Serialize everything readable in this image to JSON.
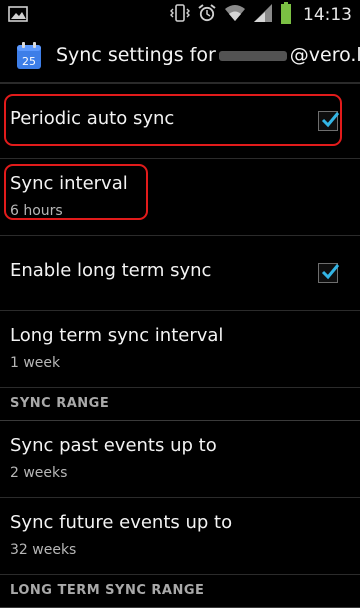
{
  "status_bar": {
    "time": "14:13",
    "icons": [
      "image-icon",
      "vibrate-icon",
      "alarm-icon",
      "wifi-icon",
      "signal-icon",
      "battery-icon"
    ]
  },
  "action_bar": {
    "title_prefix": "Sync settings for",
    "title_suffix": "@vero.lt",
    "icon": "calendar-icon",
    "icon_number": "25"
  },
  "settings": {
    "periodic_auto_sync": {
      "title": "Periodic auto sync",
      "checked": true
    },
    "sync_interval": {
      "title": "Sync interval",
      "summary": "6 hours"
    },
    "enable_long_term_sync": {
      "title": "Enable long term sync",
      "checked": true
    },
    "long_term_sync_interval": {
      "title": "Long term sync interval",
      "summary": "1 week"
    },
    "sync_range_header": "SYNC RANGE",
    "sync_past_events": {
      "title": "Sync past events up to",
      "summary": "2 weeks"
    },
    "sync_future_events": {
      "title": "Sync future events up to",
      "summary": "32 weeks"
    },
    "long_term_sync_range_header": "LONG TERM SYNC RANGE"
  },
  "colors": {
    "highlight": "#e21b1b",
    "check": "#33b5e5",
    "calendar_icon": "#3d7ee8"
  }
}
